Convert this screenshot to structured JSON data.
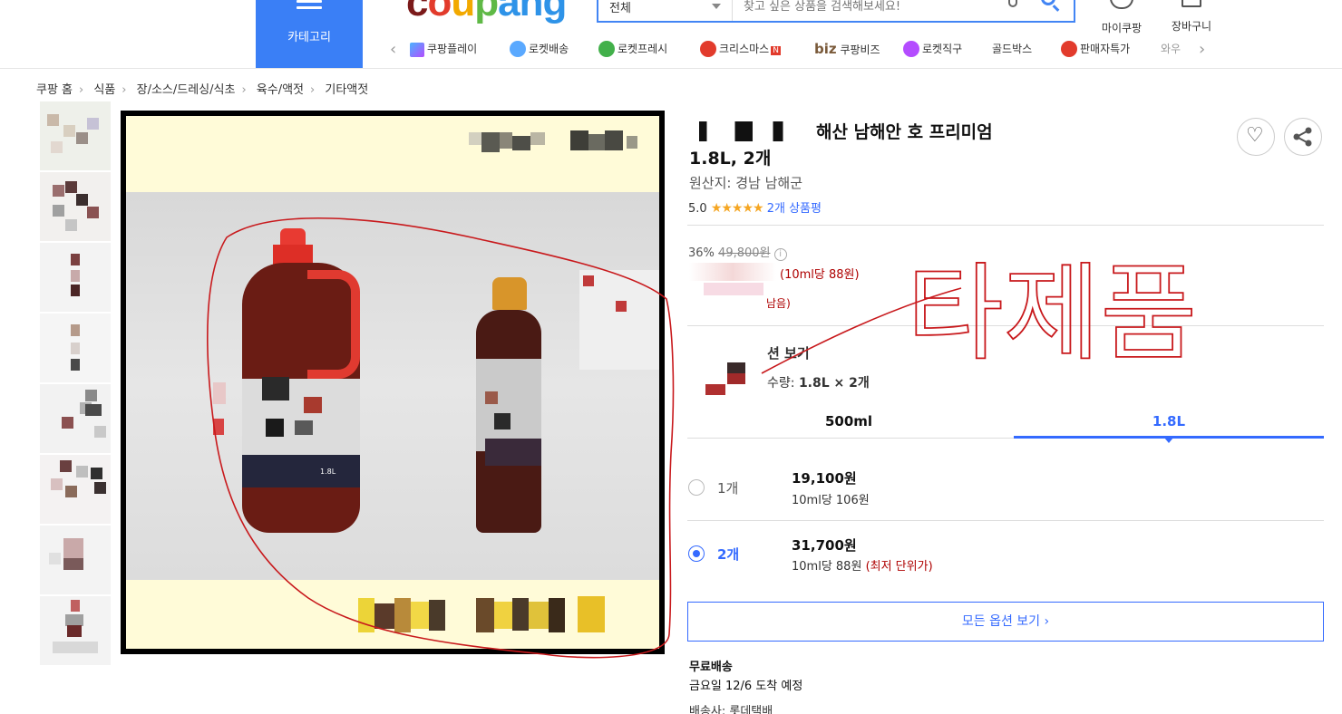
{
  "header": {
    "category_label": "카테고리",
    "logo": "coupang",
    "search_scope": "전체",
    "search_placeholder": "찾고 싶은 상품을 검색해보세요!",
    "mycoupang_label": "마이쿠팡",
    "cart_label": "장바구니"
  },
  "nav": {
    "items": [
      "쿠팡플레이",
      "로켓배송",
      "로켓프레시",
      "크리스마스",
      "쿠팡비즈",
      "로켓직구",
      "골드박스",
      "판매자특가",
      "와우"
    ],
    "biz_prefix": "biz",
    "new_badge": "N"
  },
  "breadcrumb": [
    "쿠팡 홈",
    "식품",
    "장/소스/드레싱/식초",
    "육수/액젓",
    "기타액젓"
  ],
  "main_image": {
    "bottle_label_large": "1.8L"
  },
  "product": {
    "title_line1": "해산 남해안  호 프리미엄",
    "title_line2": "1.8L, 2개",
    "origin": "원산지: 경남 남해군",
    "rating": "5.0",
    "stars": "★★★★★",
    "review_count": "2개 상품평"
  },
  "price": {
    "discount": "36%",
    "original": "49,800원",
    "info_glyph": "i",
    "unit_price": "(10ml당 88원)",
    "stock_note": "남음)"
  },
  "options": {
    "view_label": "션 보기",
    "qty_label": "수량:",
    "qty_value": "1.8L × 2개",
    "tabs": [
      "500ml",
      "1.8L"
    ],
    "rows": [
      {
        "count": "1개",
        "price": "19,100원",
        "per": "10ml당 106원",
        "lowest": ""
      },
      {
        "count": "2개",
        "price": "31,700원",
        "per": "10ml당 88원",
        "lowest": "(최저 단위가)"
      }
    ],
    "all_label": "모든 옵션 보기 ›"
  },
  "shipping": {
    "free": "무료배송",
    "eta": "금요일 12/6 도착 예정",
    "carrier": "배송사: 롯데택배"
  },
  "annotation": {
    "text": "타제품",
    "color": "#c8191c"
  },
  "colors": {
    "accent": "#346aff",
    "category_bg": "#3a7ff6",
    "sale_red": "#ae0000",
    "star": "#f5a623"
  }
}
